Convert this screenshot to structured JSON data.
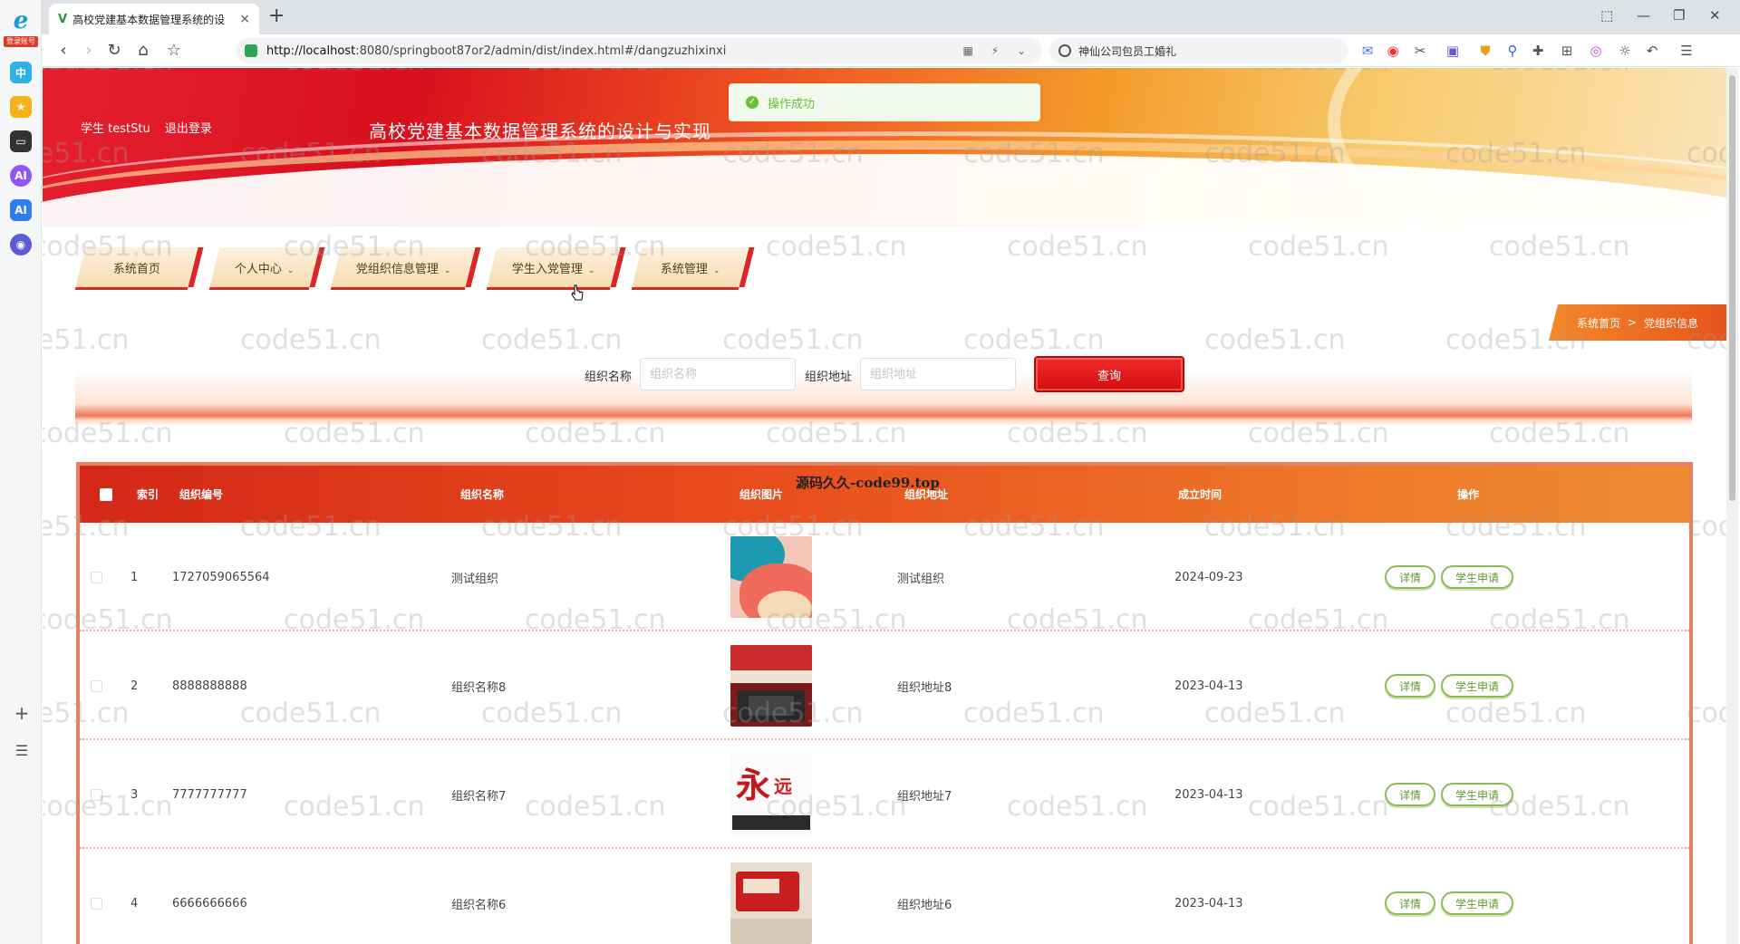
{
  "browser": {
    "tab_title": "高校党建基本数据管理系统的设",
    "tab_favicon": "V",
    "close_glyph": "×",
    "new_tab_glyph": "+",
    "url_host": "http://localhost",
    "url_rest": ":8080/springboot87or2/admin/dist/index.html#/dangzuzhixinxi",
    "search_text": "神仙公司包员工婚礼",
    "rail_logo_letter": "e",
    "rail_tag": "登录账号",
    "nav_back": "‹",
    "nav_forward": "›",
    "nav_reload": "↻",
    "nav_home": "⌂",
    "nav_star": "☆"
  },
  "header": {
    "user_label": "学生 testStu",
    "logout_label": "退出登录",
    "site_title": "高校党建基本数据管理系统的设计与实现"
  },
  "toast": {
    "message": "操作成功",
    "icon_glyph": "✓"
  },
  "menu": {
    "dropdown_glyph": "⌄",
    "items": [
      {
        "label": "系统首页"
      },
      {
        "label": "个人中心"
      },
      {
        "label": "党组织信息管理"
      },
      {
        "label": "学生入党管理"
      },
      {
        "label": "系统管理"
      }
    ]
  },
  "breadcrumb": {
    "home": "系统首页",
    "separator": ">",
    "current": "党组织信息"
  },
  "search": {
    "name_label": "组织名称",
    "name_placeholder": "组织名称",
    "name_value": "",
    "address_label": "组织地址",
    "address_placeholder": "组织地址",
    "address_value": "",
    "query_button": "查询"
  },
  "table": {
    "overlay_watermark": "源码久久-code99.top",
    "headers": {
      "index": "索引",
      "code": "组织编号",
      "name": "组织名称",
      "image": "组织图片",
      "address": "组织地址",
      "date": "成立时间",
      "actions": "操作"
    },
    "detail_label": "详情",
    "apply_label": "学生申请",
    "rows": [
      {
        "index": "1",
        "code": "1727059065564",
        "name": "测试组织",
        "address": "测试组织",
        "date": "2024-09-23",
        "image": "abstract-shapes"
      },
      {
        "index": "2",
        "code": "8888888888",
        "name": "组织名称8",
        "address": "组织地址8",
        "date": "2023-04-13",
        "image": "meeting-room"
      },
      {
        "index": "3",
        "code": "7777777777",
        "name": "组织名称7",
        "address": "组织地址7",
        "date": "2023-04-13",
        "image": "calligraphy-wall"
      },
      {
        "index": "4",
        "code": "6666666666",
        "name": "组织名称6",
        "address": "组织地址6",
        "date": "2023-04-13",
        "image": "party-hall"
      }
    ]
  },
  "watermark_text": "code51.cn",
  "colors": {
    "primary_red": "#d40d0d",
    "accent_orange": "#ef8c33",
    "success_green": "#67c23a",
    "button_green": "#8dbb57"
  }
}
